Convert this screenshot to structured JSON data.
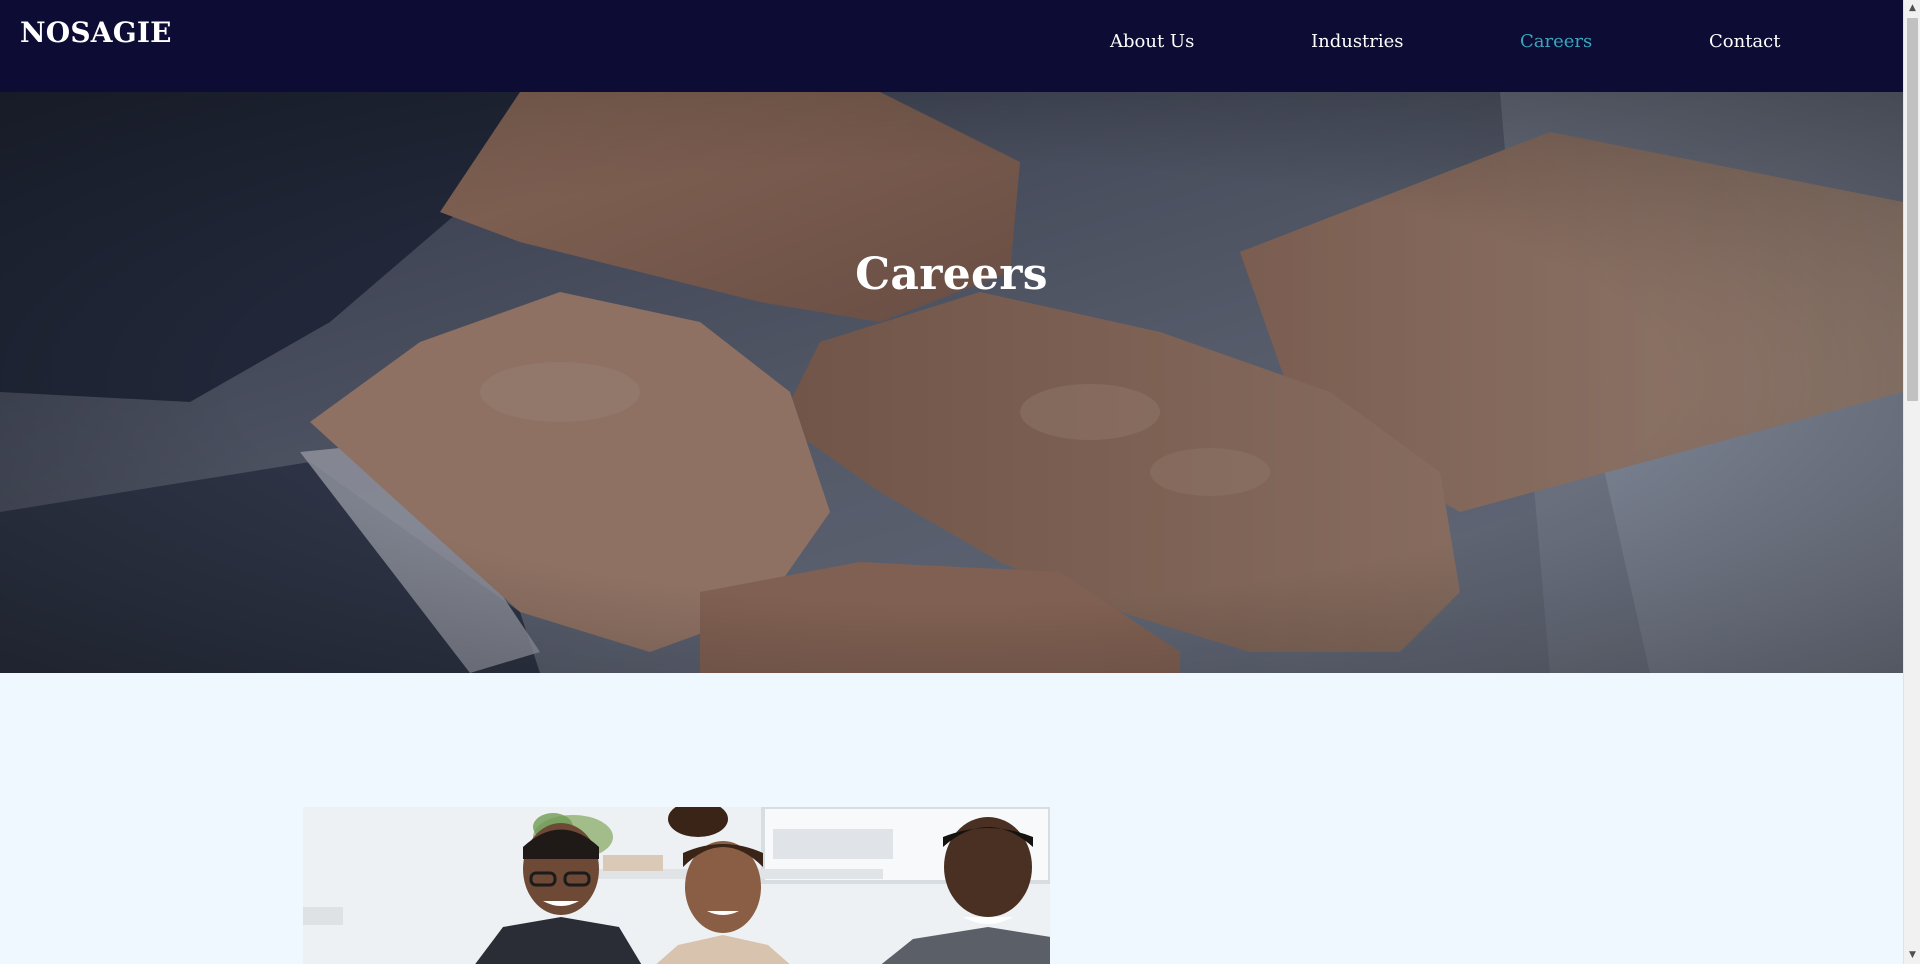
{
  "brand": {
    "name": "NOSAGIE"
  },
  "nav": {
    "items": [
      {
        "label": "About Us",
        "active": false
      },
      {
        "label": "Industries",
        "active": false
      },
      {
        "label": "Careers",
        "active": true
      },
      {
        "label": "Contact",
        "active": false
      }
    ]
  },
  "hero": {
    "title": "Careers"
  },
  "colors": {
    "header_bg": "#0c0c35",
    "active_link": "#3aa6bd",
    "page_bg": "#f0f8ff"
  },
  "images": {
    "hero": "hands-clasped-photo",
    "team": "team-of-three-smiling-photo"
  },
  "scrollbar": {
    "up_glyph": "▲",
    "down_glyph": "▼"
  }
}
